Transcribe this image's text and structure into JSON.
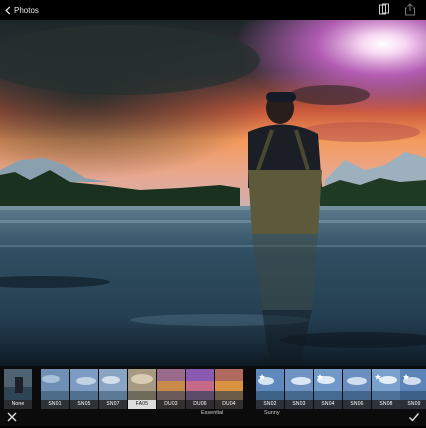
{
  "nav": {
    "back_label": "Photos"
  },
  "filters": {
    "none": {
      "label": "None"
    },
    "essential": {
      "group_label": "Essential",
      "items": [
        {
          "label": "SN01",
          "tint": "#6f8fb6"
        },
        {
          "label": "SN05",
          "tint": "#7d9bc2"
        },
        {
          "label": "SN07",
          "tint": "#8aa4c4"
        },
        {
          "label": "FA05",
          "tint": "#a89a82"
        },
        {
          "label": "DU03",
          "tint": "#c98a4a"
        },
        {
          "label": "DU06",
          "tint": "#c76a8a"
        },
        {
          "label": "DU04",
          "tint": "#d89340"
        }
      ]
    },
    "sunny": {
      "group_label": "Sunny",
      "items": [
        {
          "label": "SN02",
          "tint": "#5f88bd"
        },
        {
          "label": "SN03",
          "tint": "#6e93c3"
        },
        {
          "label": "SN04",
          "tint": "#7199c8"
        },
        {
          "label": "SN06",
          "tint": "#6a8fbf"
        },
        {
          "label": "SN08",
          "tint": "#7aa0cc"
        },
        {
          "label": "SN09",
          "tint": "#5d84b9"
        }
      ]
    }
  }
}
